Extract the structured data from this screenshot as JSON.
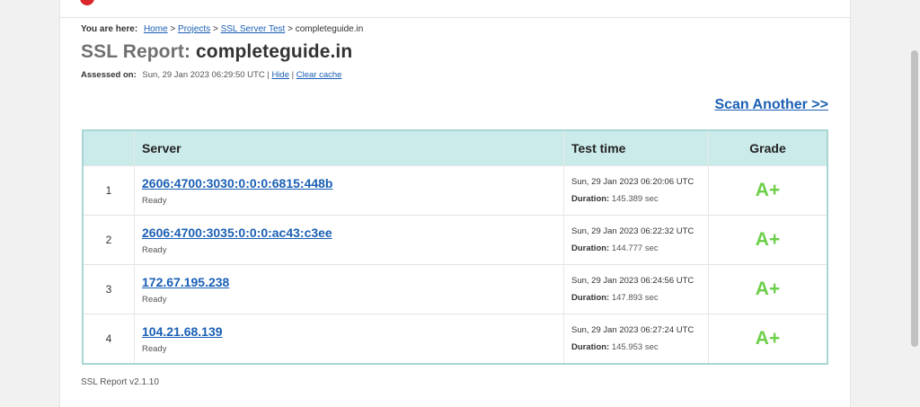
{
  "breadcrumb": {
    "prefix": "You are here:",
    "items": [
      "Home",
      "Projects",
      "SSL Server Test"
    ],
    "separator": ">",
    "current": "completeguide.in"
  },
  "report": {
    "title_prefix": "SSL Report:",
    "domain": "completeguide.in",
    "assessed_label": "Assessed on:",
    "assessed_value": "Sun, 29 Jan 2023 06:29:50 UTC",
    "hide_label": "Hide",
    "clear_cache_label": "Clear cache",
    "scan_another_label": "Scan Another >>"
  },
  "table": {
    "headers": [
      "",
      "Server",
      "Test time",
      "Grade"
    ],
    "duration_label": "Duration:",
    "rows": [
      {
        "num": "1",
        "server": "2606:4700:3030:0:0:0:6815:448b",
        "status": "Ready",
        "time": "Sun, 29 Jan 2023 06:20:06 UTC",
        "duration": "145.389 sec",
        "grade": "A+"
      },
      {
        "num": "2",
        "server": "2606:4700:3035:0:0:0:ac43:c3ee",
        "status": "Ready",
        "time": "Sun, 29 Jan 2023 06:22:32 UTC",
        "duration": "144.777 sec",
        "grade": "A+"
      },
      {
        "num": "3",
        "server": "172.67.195.238",
        "status": "Ready",
        "time": "Sun, 29 Jan 2023 06:24:56 UTC",
        "duration": "147.893 sec",
        "grade": "A+"
      },
      {
        "num": "4",
        "server": "104.21.68.139",
        "status": "Ready",
        "time": "Sun, 29 Jan 2023 06:27:24 UTC",
        "duration": "145.953 sec",
        "grade": "A+"
      }
    ]
  },
  "footer": {
    "version": "SSL Report v2.1.10"
  },
  "colors": {
    "accent_link": "#1a5fb4",
    "grade_green": "#6ccf4a",
    "header_teal": "#cbebea",
    "logo_red": "#d9262a"
  }
}
